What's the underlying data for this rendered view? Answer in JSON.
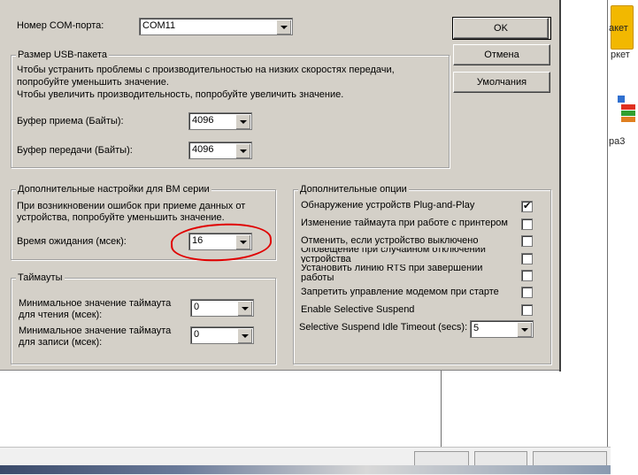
{
  "com_port": {
    "label": "Номер COM-порта:",
    "value": "COM11"
  },
  "buttons": {
    "ok": "OK",
    "cancel": "Отмена",
    "defaults": "Умолчания"
  },
  "usb_group": {
    "title": "Размер USB-пакета",
    "hint1": "Чтобы устранить проблемы с производительностью на низких скоростях передачи,",
    "hint2": "попробуйте уменьшить значение.",
    "hint3": "Чтобы увеличить производительность, попробуйте увеличить значение.",
    "rx_label": "Буфер приема (Байты):",
    "rx_value": "4096",
    "tx_label": "Буфер передачи (Байты):",
    "tx_value": "4096"
  },
  "bm_group": {
    "title": "Дополнительные настройки для ВМ серии",
    "hint1": "При возникновении ошибок при приеме данных от",
    "hint2": "устройства, попробуйте уменьшить значение.",
    "latency_label": "Время ожидания (мсек):",
    "latency_value": "16"
  },
  "timeouts_group": {
    "title": "Таймауты",
    "read_label1": "Минимальное значение таймаута",
    "read_label2": "для чтения (мсек):",
    "read_value": "0",
    "write_label1": "Минимальное значение таймаута",
    "write_label2": "для записи (мсек):",
    "write_value": "0"
  },
  "options_group": {
    "title": "Дополнительные опции",
    "items": [
      {
        "label": "Обнаружение устройств Plug-and-Play",
        "checked": true
      },
      {
        "label": "Изменение таймаута при работе с принтером",
        "checked": false
      },
      {
        "label": "Отменить, если устройство выключено",
        "checked": false
      },
      {
        "label": "Оповещение при случайном отключении",
        "label2": "устройства",
        "checked": false
      },
      {
        "label": "Установить линию RTS при завершении",
        "label2": "работы",
        "checked": false
      },
      {
        "label": "Запретить управление модемом при старте",
        "checked": false
      },
      {
        "label": "Enable Selective Suspend",
        "checked": false
      }
    ],
    "idle_label": "Selective Suspend Idle Timeout (secs):",
    "idle_value": "5"
  },
  "desktop": {
    "icon1_text": "акет",
    "icon2_text": "ра3",
    "icon3_text": "ркет"
  },
  "colors": {
    "dialog_bg": "#d4d0c8",
    "highlight_ring": "#e00000"
  }
}
